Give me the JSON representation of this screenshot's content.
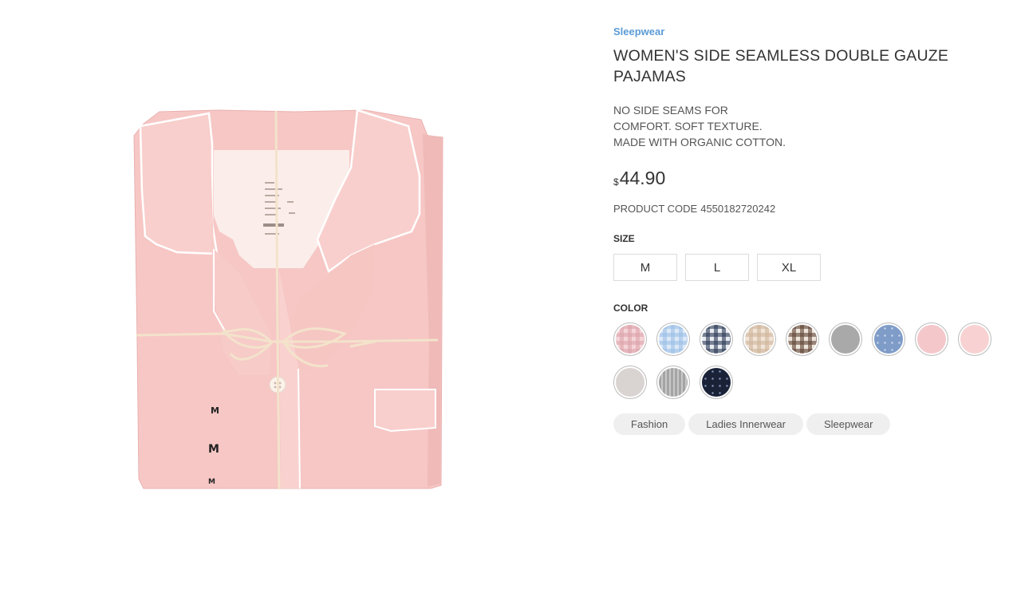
{
  "product": {
    "category": "Sleepwear",
    "title": "WOMEN'S SIDE SEAMLESS DOUBLE GAUZE PAJAMAS",
    "description": [
      "NO SIDE SEAMS FOR",
      "COMFORT. SOFT TEXTURE.",
      "MADE WITH ORGANIC COTTON."
    ],
    "price": {
      "currency": "$",
      "amount": "44.90"
    },
    "code_label": "PRODUCT CODE",
    "code": "4550182720242",
    "image_label_letters": [
      "M",
      "M",
      "M"
    ]
  },
  "size": {
    "label": "SIZE",
    "options": [
      "M",
      "L",
      "XL"
    ]
  },
  "color": {
    "label": "COLOR",
    "swatches": [
      {
        "name": "pink-check",
        "pattern": "check",
        "base": "#f4d4d8",
        "line": "#dba3ab"
      },
      {
        "name": "blue-check",
        "pattern": "check",
        "base": "#dce9f7",
        "line": "#9cc0e6"
      },
      {
        "name": "navy-check",
        "pattern": "check",
        "base": "#e8ecf2",
        "line": "#2b3a55"
      },
      {
        "name": "beige-check",
        "pattern": "check",
        "base": "#f1e4d7",
        "line": "#cfb49b"
      },
      {
        "name": "brown-check",
        "pattern": "check",
        "base": "#ede5dc",
        "line": "#5e4234"
      },
      {
        "name": "gray",
        "pattern": "solid",
        "base": "#a9a9a9",
        "line": "#999999"
      },
      {
        "name": "blue-dot",
        "pattern": "dot",
        "base": "#7f9cc8",
        "line": "#c8d6ec"
      },
      {
        "name": "light-pink",
        "pattern": "solid",
        "base": "#f4c8cb",
        "line": "#efc0c3"
      },
      {
        "name": "pale-pink",
        "pattern": "solid",
        "base": "#f8d2d2",
        "line": "#f1c6c6"
      },
      {
        "name": "light-gray",
        "pattern": "solid",
        "base": "#d9d4d1",
        "line": "#cac5c2"
      },
      {
        "name": "gray-stripe",
        "pattern": "stripe",
        "base": "#a4a4a4",
        "line": "#c8c8c8"
      },
      {
        "name": "navy-dot",
        "pattern": "dot",
        "base": "#1a2238",
        "line": "#8390b0"
      }
    ]
  },
  "tags": [
    "Fashion",
    "Ladies Innerwear",
    "Sleepwear"
  ]
}
